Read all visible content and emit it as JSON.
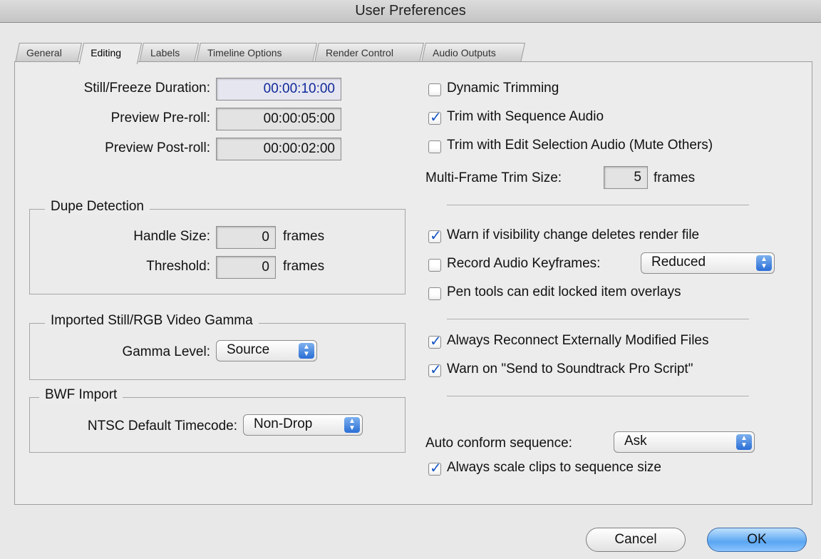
{
  "window": {
    "title": "User Preferences"
  },
  "tabs": [
    {
      "label": "General"
    },
    {
      "label": "Editing"
    },
    {
      "label": "Labels"
    },
    {
      "label": "Timeline Options"
    },
    {
      "label": "Render Control"
    },
    {
      "label": "Audio Outputs"
    }
  ],
  "editing": {
    "still_freeze": {
      "label": "Still/Freeze Duration:",
      "value": "00:00:10:00"
    },
    "preroll": {
      "label": "Preview Pre-roll:",
      "value": "00:00:05:00"
    },
    "postroll": {
      "label": "Preview Post-roll:",
      "value": "00:00:02:00"
    },
    "dupe": {
      "title": "Dupe Detection",
      "handle_label": "Handle Size:",
      "handle_value": "0",
      "handle_unit": "frames",
      "threshold_label": "Threshold:",
      "threshold_value": "0",
      "threshold_unit": "frames"
    },
    "gamma": {
      "title": "Imported Still/RGB Video Gamma",
      "label": "Gamma Level:",
      "value": "Source"
    },
    "bwf": {
      "title": "BWF Import",
      "label": "NTSC Default Timecode:",
      "value": "Non-Drop"
    },
    "dynamic_trimming": {
      "label": "Dynamic Trimming",
      "checked": false
    },
    "trim_seq_audio": {
      "label": "Trim with Sequence Audio",
      "checked": true
    },
    "trim_edit_sel": {
      "label": "Trim with Edit Selection Audio (Mute Others)",
      "checked": false
    },
    "multiframe": {
      "label": "Multi-Frame Trim Size:",
      "value": "5",
      "unit": "frames"
    },
    "warn_visibility": {
      "label": "Warn if visibility change deletes render file",
      "checked": true
    },
    "record_audio_kf": {
      "label": "Record Audio Keyframes:",
      "checked": false,
      "value": "Reduced"
    },
    "pen_tools": {
      "label": "Pen tools can edit locked item overlays",
      "checked": false
    },
    "always_reconnect": {
      "label": "Always Reconnect Externally Modified Files",
      "checked": true
    },
    "warn_soundtrack": {
      "label": "Warn on \"Send to Soundtrack Pro Script\"",
      "checked": true
    },
    "auto_conform": {
      "label": "Auto conform sequence:",
      "value": "Ask"
    },
    "always_scale": {
      "label": "Always scale clips to sequence size",
      "checked": true
    }
  },
  "buttons": {
    "cancel": "Cancel",
    "ok": "OK"
  },
  "icons": {
    "checkmark": "checkmark-icon",
    "popup_arrows": "updown-arrows-icon"
  },
  "colors": {
    "accent": "#2a6ed6",
    "panel": "#ececec",
    "window": "#e8e8e8"
  }
}
